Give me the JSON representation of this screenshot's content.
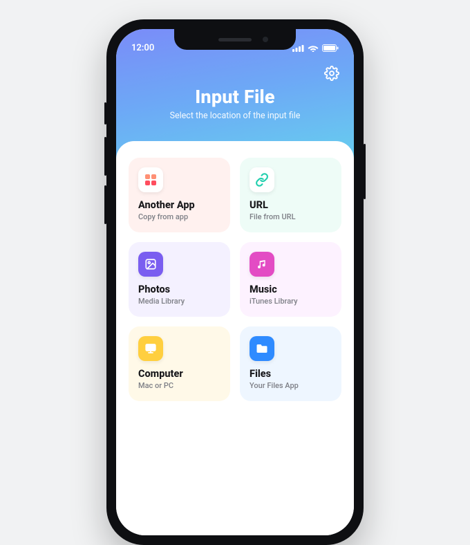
{
  "status": {
    "time": "12:00"
  },
  "header": {
    "title": "Input File",
    "subtitle": "Select the location of the input file"
  },
  "cards": [
    {
      "title": "Another App",
      "sub": "Copy from app"
    },
    {
      "title": "URL",
      "sub": "File from URL"
    },
    {
      "title": "Photos",
      "sub": "Media Library"
    },
    {
      "title": "Music",
      "sub": "iTunes Library"
    },
    {
      "title": "Computer",
      "sub": "Mac or PC"
    },
    {
      "title": "Files",
      "sub": "Your Files App"
    }
  ]
}
